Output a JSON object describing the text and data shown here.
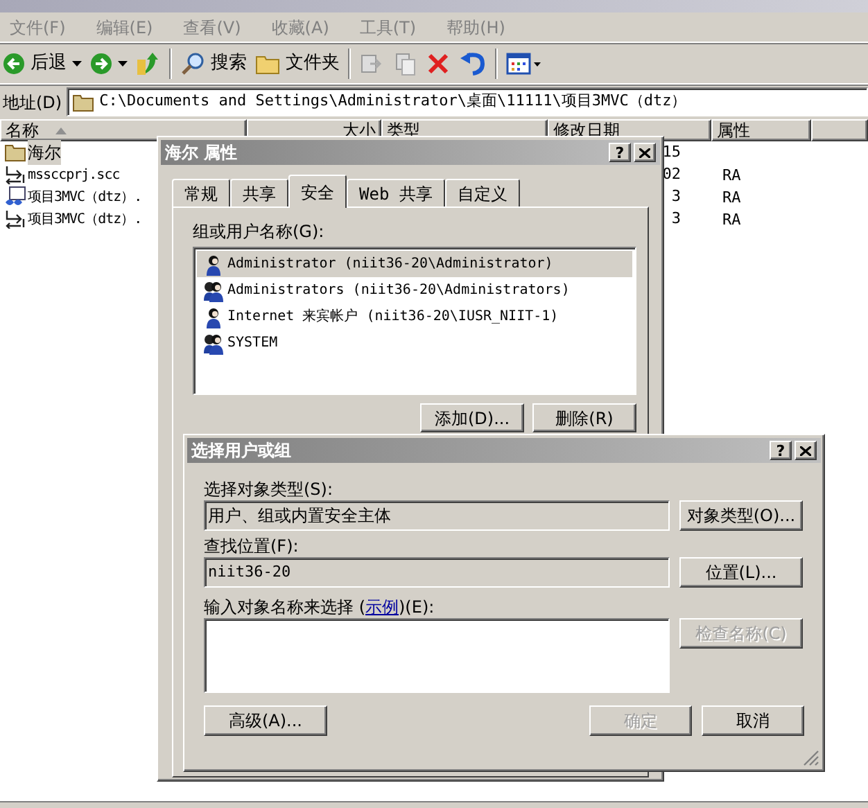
{
  "menu": [
    "文件(F)",
    "编辑(E)",
    "查看(V)",
    "收藏(A)",
    "工具(T)",
    "帮助(H)"
  ],
  "toolbar": [
    {
      "kind": "back",
      "label": "后退"
    },
    {
      "kind": "forward"
    },
    {
      "kind": "up"
    },
    {
      "kind": "search",
      "label": "搜索"
    },
    {
      "kind": "folders",
      "label": "文件夹"
    },
    {
      "kind": "move"
    },
    {
      "kind": "copy"
    },
    {
      "kind": "delete"
    },
    {
      "kind": "undo"
    },
    {
      "kind": "views"
    }
  ],
  "address": {
    "label": "地址(D)",
    "value": "C:\\Documents and Settings\\Administrator\\桌面\\11111\\项目3MVC（dtz）"
  },
  "columns": [
    "名称",
    "大小",
    "类型",
    "修改日期",
    "属性"
  ],
  "files": [
    {
      "kind": "folder",
      "name": "海尔",
      "date": "15",
      "selected": true
    },
    {
      "kind": "scc",
      "name": "mssccprj.scc",
      "date": "02",
      "attributes": "RA",
      "selected": false
    },
    {
      "kind": "project",
      "name": "项目3MVC（dtz）.",
      "date": "3",
      "attributes": "RA",
      "selected": false
    },
    {
      "kind": "scc",
      "name": "项目3MVC（dtz）.",
      "date": "3",
      "attributes": "RA",
      "selected": false
    }
  ],
  "properties": {
    "title": "海尔 属性",
    "help": "?",
    "tabs": [
      {
        "label": "常规",
        "selected": false
      },
      {
        "label": "共享",
        "selected": false
      },
      {
        "label": "安全",
        "selected": true
      },
      {
        "label": "Web 共享",
        "selected": false
      },
      {
        "label": "自定义",
        "selected": false
      }
    ],
    "list_label": "组或用户名称(G):",
    "principals": [
      {
        "kind": "user",
        "name": "Administrator (niit36-20\\Administrator)",
        "selected": true
      },
      {
        "kind": "group",
        "name": "Administrators (niit36-20\\Administrators)",
        "selected": false
      },
      {
        "kind": "user",
        "name": "Internet 来宾帐户 (niit36-20\\IUSR_NIIT-1)",
        "selected": false
      },
      {
        "kind": "group",
        "name": "SYSTEM",
        "selected": false
      }
    ],
    "buttons": [
      "添加(D)...",
      "删除(R)"
    ]
  },
  "select_dialog": {
    "title": "选择用户或组",
    "help": "?",
    "object_types": {
      "label": "选择对象类型(S):",
      "value": "用户、组或内置安全主体",
      "button": "对象类型(O)..."
    },
    "location": {
      "label": "查找位置(F):",
      "value": "niit36-20",
      "button": "位置(L)..."
    },
    "names": {
      "label_before": "输入对象名称来选择 (",
      "link": "示例",
      "label_after": ")(E):",
      "button": {
        "label": "检查名称(C)",
        "disabled": true
      }
    },
    "buttons": [
      {
        "label": "高级(A)...",
        "disabled": false
      },
      {
        "label": "确定",
        "disabled": true
      },
      {
        "label": "取消",
        "disabled": false
      }
    ]
  }
}
